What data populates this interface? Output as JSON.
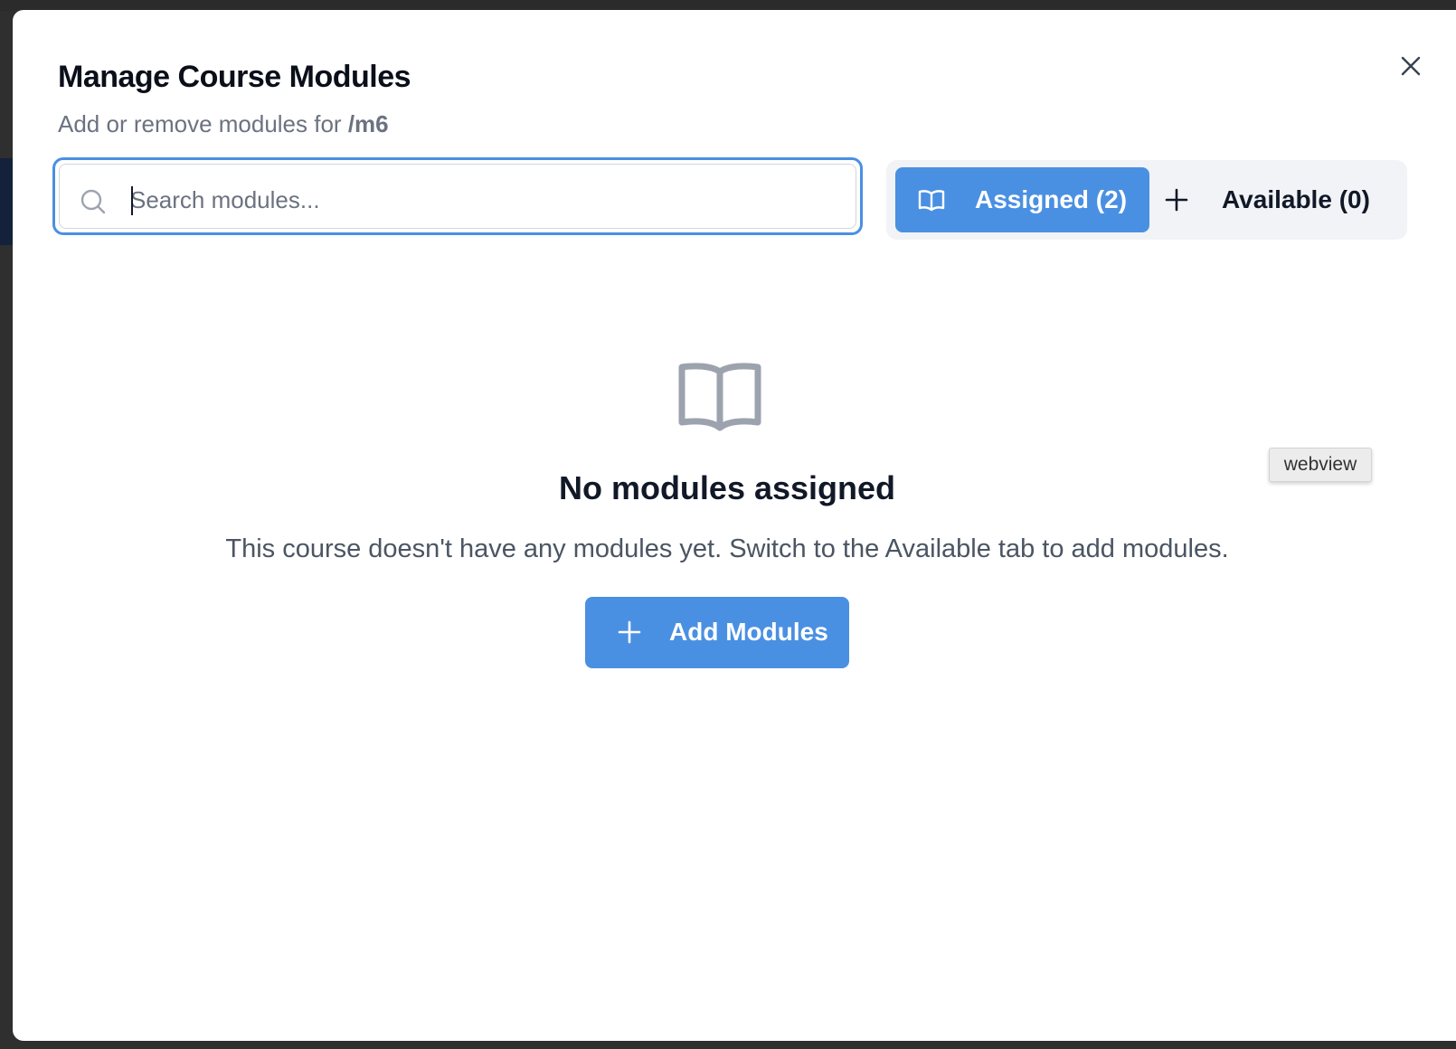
{
  "dialog": {
    "title": "Manage Course Modules",
    "subtitle_prefix": "Add or remove modules for",
    "course_name": "/m6",
    "close_icon": "close-icon"
  },
  "search": {
    "placeholder": "Search modules...",
    "value": "",
    "icon": "search-icon"
  },
  "tabs": [
    {
      "label": "Assigned (2)",
      "icon": "book-open-icon",
      "active": true
    },
    {
      "label": "Available (0)",
      "icon": "plus-icon",
      "active": false
    }
  ],
  "empty_state": {
    "icon": "book-open-icon",
    "title": "No modules assigned",
    "description": "This course doesn't have any modules yet. Switch to the Available tab to add modules.",
    "button_label": "Add Modules",
    "button_icon": "plus-icon"
  },
  "tooltip": {
    "text": "webview"
  },
  "colors": {
    "accent": "#4a90e2",
    "tab_bar_bg": "#f1f3f6",
    "muted_text": "#6b7280",
    "heading_text": "#111827"
  }
}
